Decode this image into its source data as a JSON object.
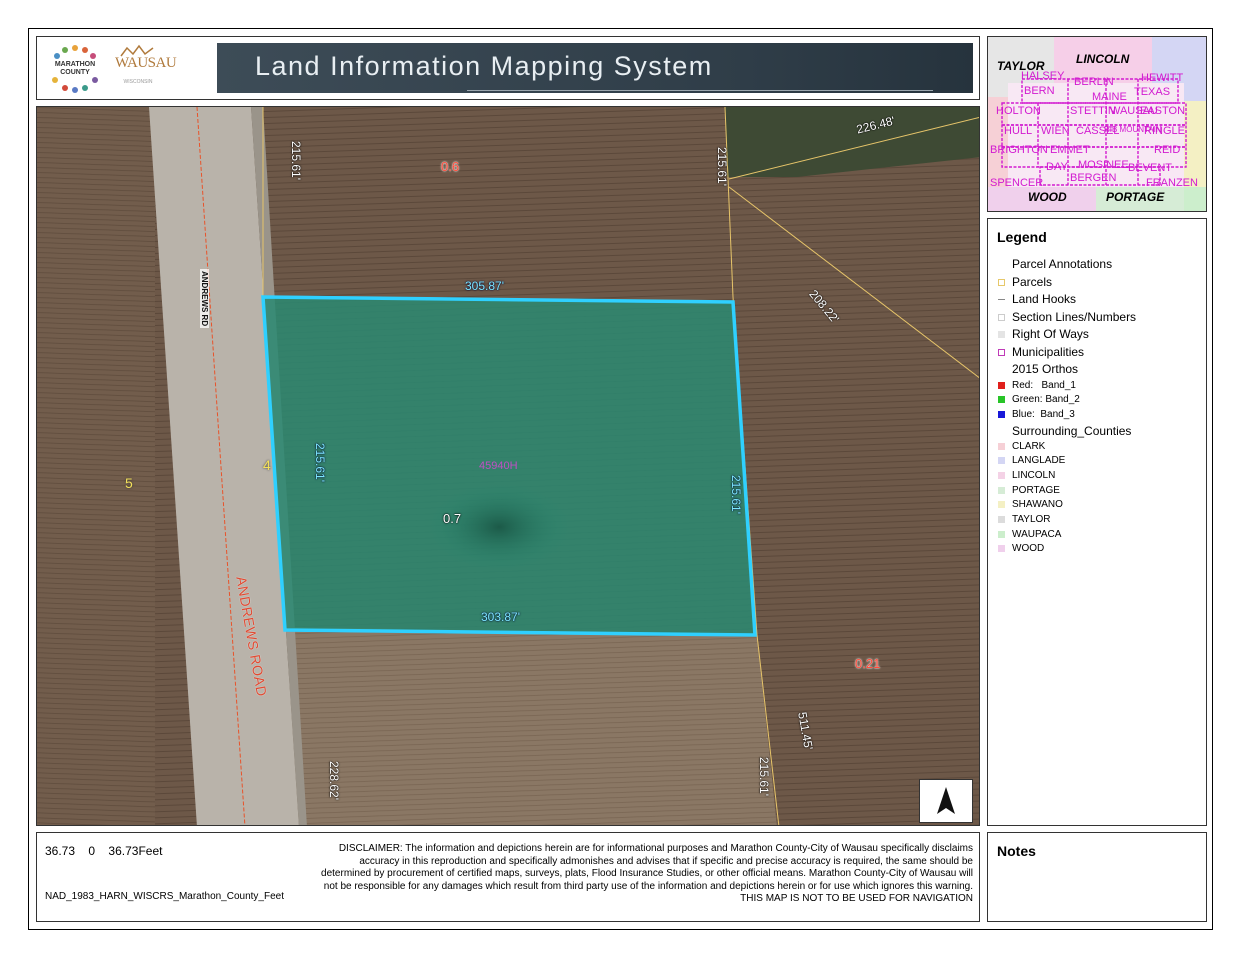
{
  "header": {
    "title": "Land Information Mapping System",
    "county_logo_text": "MARATHON COUNTY",
    "city_logo_text": "WAUSAU",
    "city_logo_sub": "WISCONSIN"
  },
  "map": {
    "road_label_small": "ANDREWS RD",
    "road_label_large": "ANDREWS ROAD",
    "annotations": {
      "north_width": "305.87'",
      "south_width": "303.87'",
      "west_depth": "215.61'",
      "east_depth": "215.61'",
      "acreage_parcel": "0.7",
      "acreage_north": "0.6",
      "acreage_east": "0.21",
      "nw_depth": "215.61'",
      "ne_depth": "215.61'",
      "ne_diag": "226.48'",
      "east_diag": "208.22'",
      "se_diag": "511.45'",
      "se_depth": "215.61'",
      "sw_depth": "228.62'",
      "left_num": "5",
      "road_num": "4",
      "parcel_id": "45940H"
    },
    "colors": {
      "parcel_outline": "#2fd0ff",
      "parcel_fill": "#2a8a72",
      "field": "#6b5747",
      "road": "#b9b3aa"
    }
  },
  "overview": {
    "counties": [
      "TAYLOR",
      "LINCOLN",
      "WOOD",
      "PORTAGE"
    ],
    "municipalities": [
      "HALSEY",
      "BERLIN",
      "HEWITT",
      "BERN",
      "MAINE",
      "TEXAS",
      "HOLTON",
      "STETTIN",
      "WAUSAU",
      "EASTON",
      "HULL",
      "WIEN",
      "CASSEL",
      "RIB MOUNTAIN",
      "RINGLE",
      "BRIGHTON",
      "EMMET",
      "REID",
      "DAY",
      "MOSINEE",
      "BEVENT",
      "SPENCER",
      "BERGEN",
      "FRANZEN"
    ]
  },
  "legend": {
    "title": "Legend",
    "items": [
      {
        "label": "Parcel Annotations",
        "swatch": "none"
      },
      {
        "label": "Parcels",
        "swatch": "#e6c86a"
      },
      {
        "label": "Land Hooks",
        "swatch": "line"
      },
      {
        "label": "Section Lines/Numbers",
        "swatch": "#d0d0d0"
      },
      {
        "label": "Right Of Ways",
        "swatch": "#e4e4e4"
      },
      {
        "label": "Municipalities",
        "swatch": "#c03ab8"
      },
      {
        "label": "2015 Orthos",
        "swatch": "none"
      }
    ],
    "bands": [
      {
        "label": "Red:   Band_1",
        "color": "#e0201c"
      },
      {
        "label": "Green: Band_2",
        "color": "#28c428"
      },
      {
        "label": "Blue:  Band_3",
        "color": "#1818d8"
      }
    ],
    "surrounding_title": "Surrounding_Counties",
    "counties": [
      {
        "label": "CLARK",
        "color": "#f6d0d6"
      },
      {
        "label": "LANGLADE",
        "color": "#d4d6f4"
      },
      {
        "label": "LINCOLN",
        "color": "#f4d2e6"
      },
      {
        "label": "PORTAGE",
        "color": "#d6ecd6"
      },
      {
        "label": "SHAWANO",
        "color": "#f4f0c4"
      },
      {
        "label": "TAYLOR",
        "color": "#dcdcdc"
      },
      {
        "label": "WAUPACA",
        "color": "#cceecc"
      },
      {
        "label": "WOOD",
        "color": "#f0d0ec"
      }
    ]
  },
  "scale": {
    "left": "36.73",
    "zero": "0",
    "right": "36.73",
    "unit": "Feet",
    "projection": "NAD_1983_HARN_WISCRS_Marathon_County_Feet"
  },
  "disclaimer": {
    "text": "DISCLAIMER: The information and depictions herein are for informational purposes and Marathon County-City of Wausau specifically disclaims accuracy in this reproduction and specifically admonishes and advises that if specific and precise accuracy is required, the same should be determined by procurement of certified maps, surveys, plats, Flood Insurance Studies, or other official means. Marathon County-City of Wausau will not be responsible for any damages which result from third party use of the information and depictions herein or for use which ignores this warning.",
    "warning": "THIS MAP IS NOT TO BE USED FOR NAVIGATION"
  },
  "notes": {
    "title": "Notes"
  }
}
